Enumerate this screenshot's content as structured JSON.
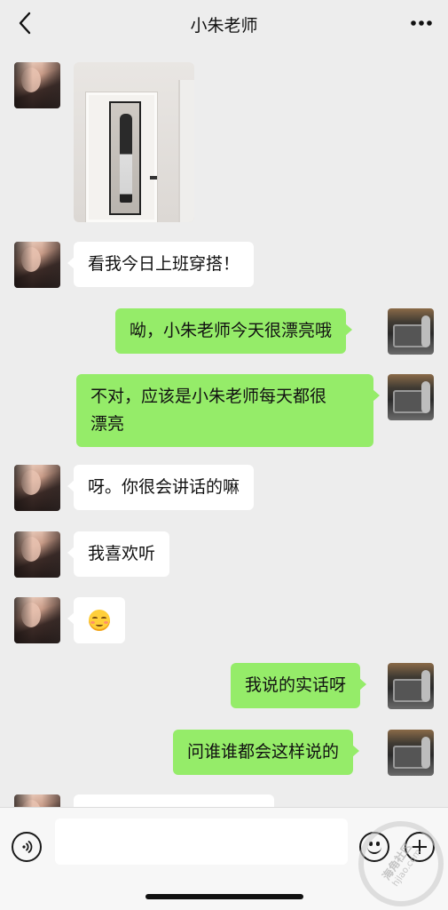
{
  "header": {
    "back_icon": "chevron-left-icon",
    "title": "小朱老师",
    "more_icon": "more-dots-icon"
  },
  "messages": [
    {
      "sender": "contact",
      "type": "image"
    },
    {
      "sender": "contact",
      "type": "text",
      "text": "看我今日上班穿搭！"
    },
    {
      "sender": "me",
      "type": "text",
      "text": "呦，小朱老师今天很漂亮哦"
    },
    {
      "sender": "me",
      "type": "text",
      "text": "不对，应该是小朱老师每天都很\n漂亮"
    },
    {
      "sender": "contact",
      "type": "text",
      "text": "呀。你很会讲话的嘛"
    },
    {
      "sender": "contact",
      "type": "text",
      "text": "我喜欢听"
    },
    {
      "sender": "contact",
      "type": "emoji",
      "emoji": "blush-emoji"
    },
    {
      "sender": "me",
      "type": "text",
      "text": "我说的实话呀"
    },
    {
      "sender": "me",
      "type": "text",
      "text": "问谁谁都会这样说的"
    }
  ],
  "input_bar": {
    "voice_icon": "voice-icon",
    "input_value": "",
    "emoji_icon": "smiley-icon",
    "plus_icon": "plus-icon"
  },
  "watermark": {
    "text_main": "海角社区",
    "text_sub": "hjlao.com"
  },
  "colors": {
    "background": "#ededed",
    "outgoing_bubble": "#95ec69",
    "incoming_bubble": "#ffffff"
  }
}
